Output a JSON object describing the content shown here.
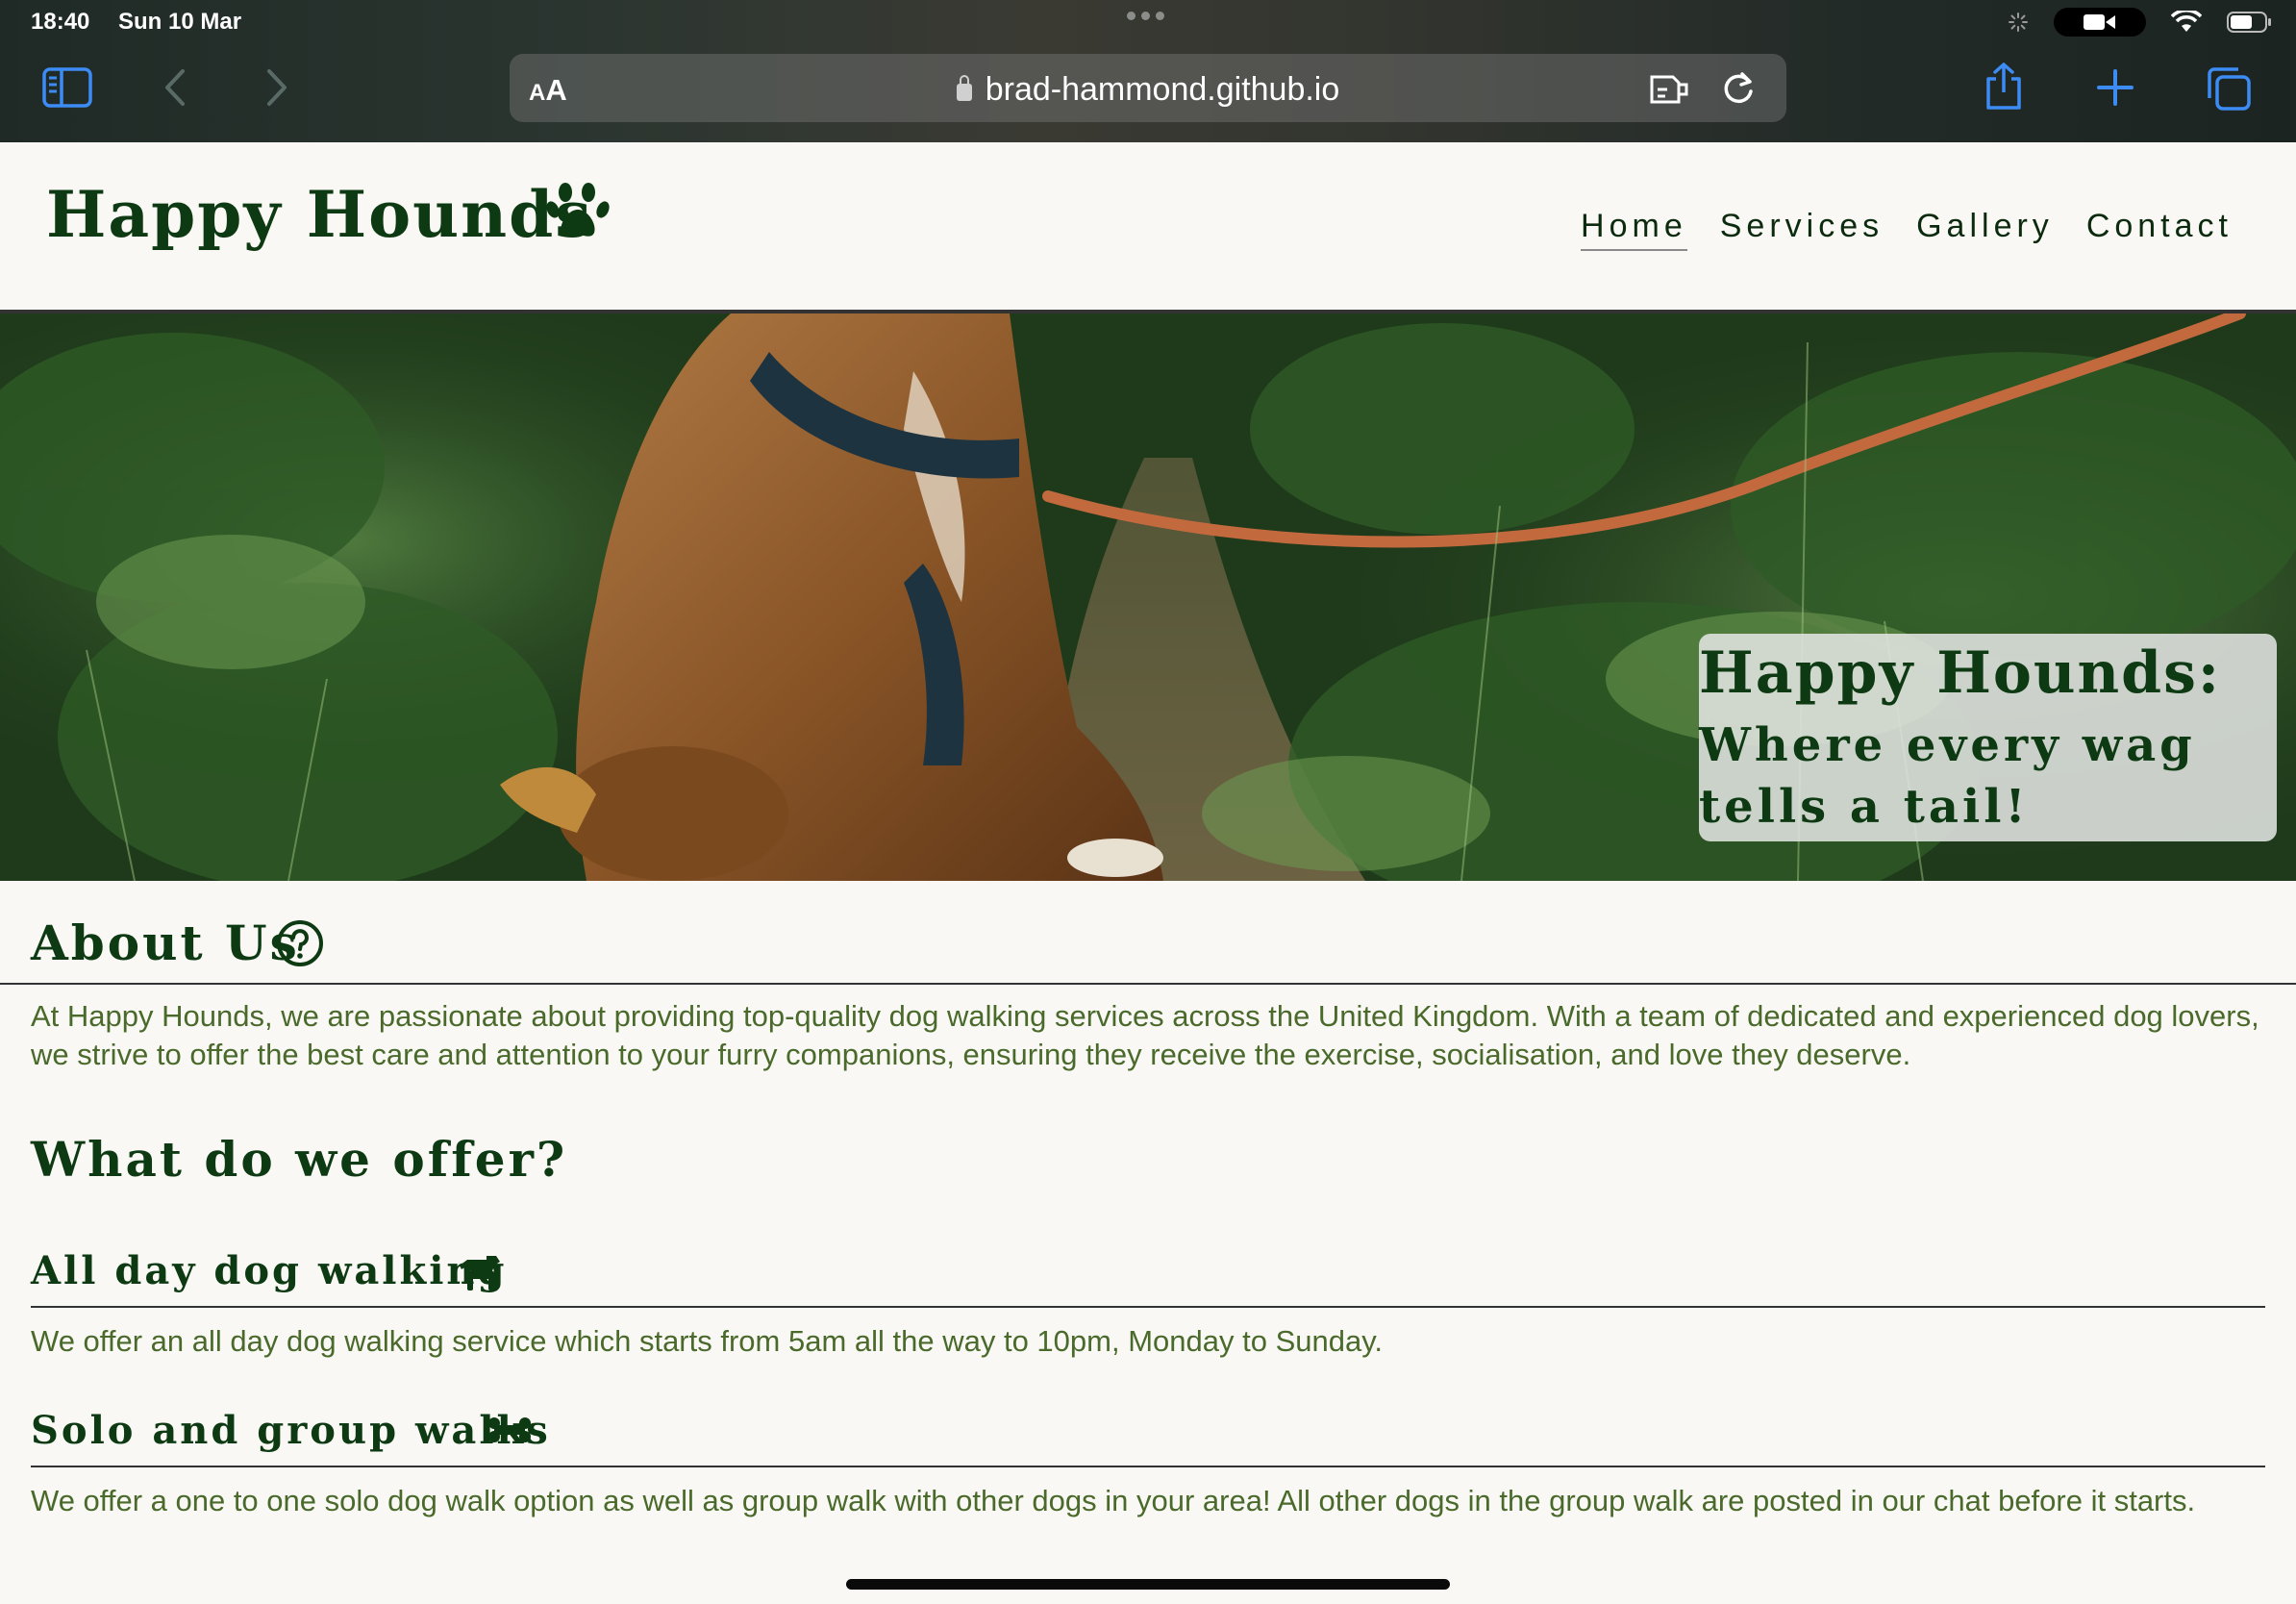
{
  "status_bar": {
    "time": "18:40",
    "date": "Sun 10 Mar"
  },
  "browser": {
    "aa_small": "A",
    "aa_big": "A",
    "url": "brad-hammond.github.io",
    "accent_color": "#3d8cf5"
  },
  "header": {
    "logo_text": "Happy Hounds",
    "nav": [
      {
        "label": "Home",
        "active": true
      },
      {
        "label": "Services",
        "active": false
      },
      {
        "label": "Gallery",
        "active": false
      },
      {
        "label": "Contact",
        "active": false
      }
    ]
  },
  "hero": {
    "title": "Happy Hounds:",
    "subtitle": "Where every wag tells a tail!"
  },
  "about": {
    "heading": "About Us",
    "body": "At Happy Hounds, we are passionate about providing top-quality dog walking services across the United Kingdom. With a team of dedicated and experienced dog lovers, we strive to offer the best care and attention to your furry companions, ensuring they receive the exercise, socialisation, and love they deserve."
  },
  "offer": {
    "heading": "What do we offer?",
    "items": [
      {
        "title": "All day dog walking",
        "icon": "dog-icon",
        "body": "We offer an all day dog walking service which starts from 5am all the way to 10pm, Monday to Sunday."
      },
      {
        "title": "Solo and group walks",
        "icon": "bone-icon",
        "body": "We offer a one to one solo dog walk option as well as group walk with other dogs in your area! All other dogs in the group walk are posted in our chat before it starts."
      }
    ]
  },
  "colors": {
    "brand_green": "#0d3a12",
    "body_text": "#4a6a2c",
    "page_bg": "#f9f8f4"
  }
}
